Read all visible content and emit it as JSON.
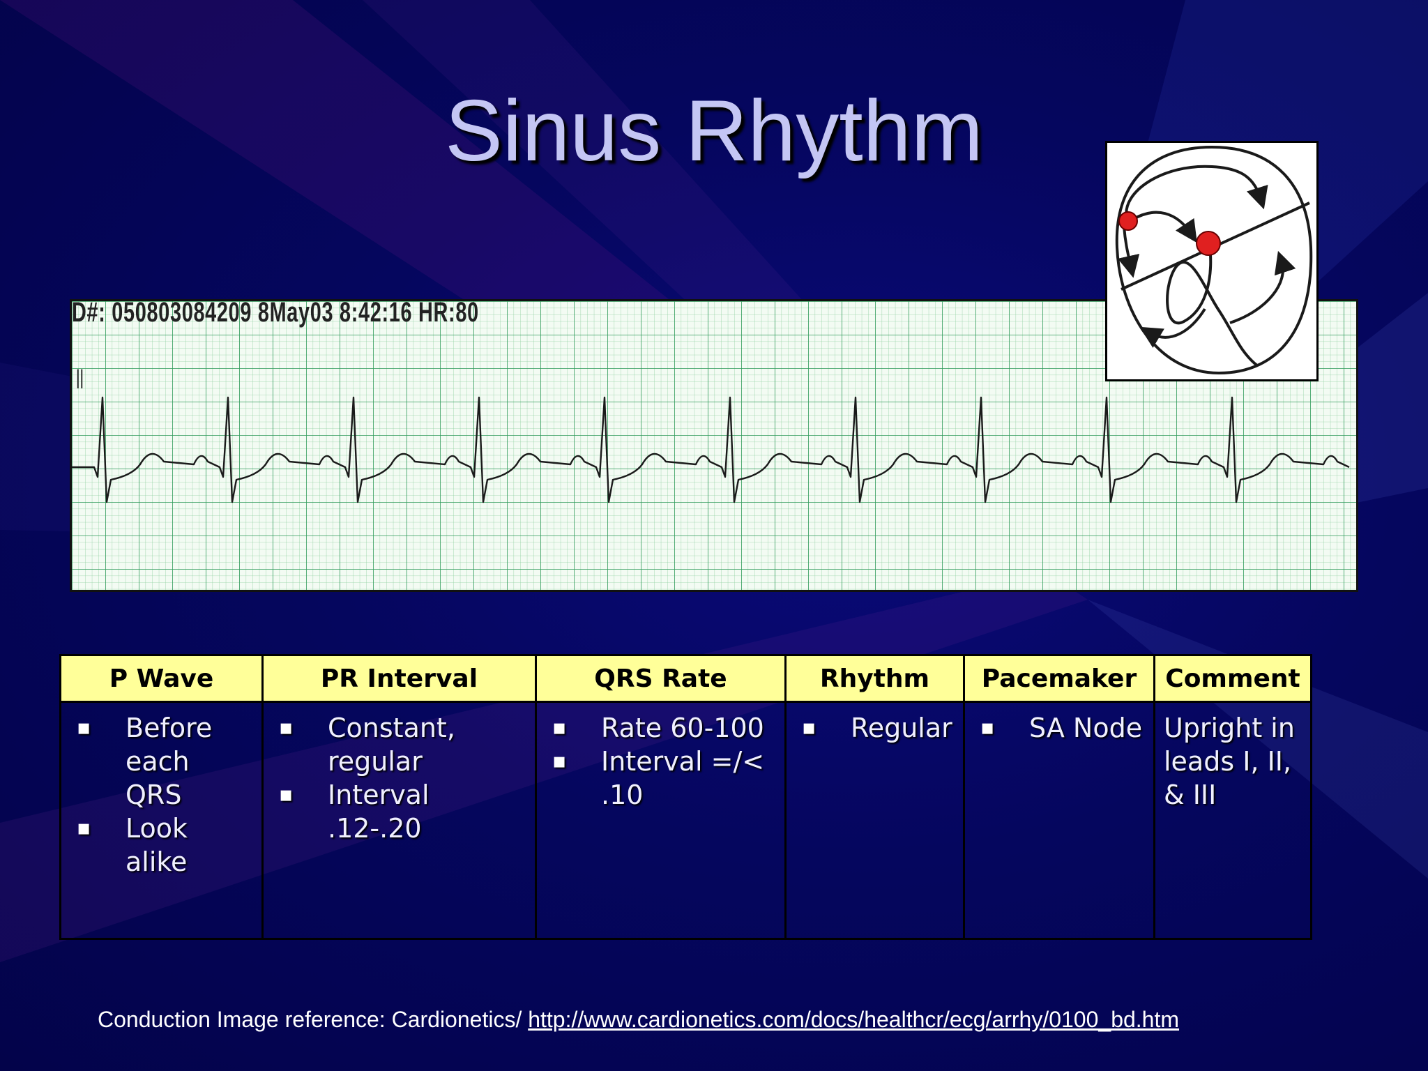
{
  "slide": {
    "title": "Sinus Rhythm"
  },
  "ecg": {
    "header_text": "D#: 050803084209 8May03 8:42:16 HR:80",
    "lead_label": "II",
    "heart_rate_bpm": 80
  },
  "table": {
    "headers": [
      "P Wave",
      "PR Interval",
      "QRS Rate",
      "Rhythm",
      "Pacemaker",
      "Comment"
    ],
    "cells": {
      "p_wave": [
        "Before each QRS",
        "Look alike"
      ],
      "pr_interval": [
        "Constant, regular",
        "Interval .12-.20"
      ],
      "qrs_rate": [
        "Rate 60-100",
        "Interval =/< .10"
      ],
      "rhythm": [
        "Regular"
      ],
      "pacemaker": [
        "SA Node"
      ],
      "comment": "Upright in leads I, II, & III"
    }
  },
  "footer": {
    "reference_prefix": "Conduction Image reference:  Cardionetics/ ",
    "reference_url": "http://www.cardionetics.com/docs/healthcr/ecg/arrhy/0100_bd.htm"
  },
  "colors": {
    "background": "#05065e",
    "title": "#c4c6f4",
    "table_header_bg": "#ffff99",
    "ecg_grid": "#2f9a5a",
    "node_red": "#e02020"
  },
  "icons": {
    "bullet": "small-square-bullet-icon"
  }
}
